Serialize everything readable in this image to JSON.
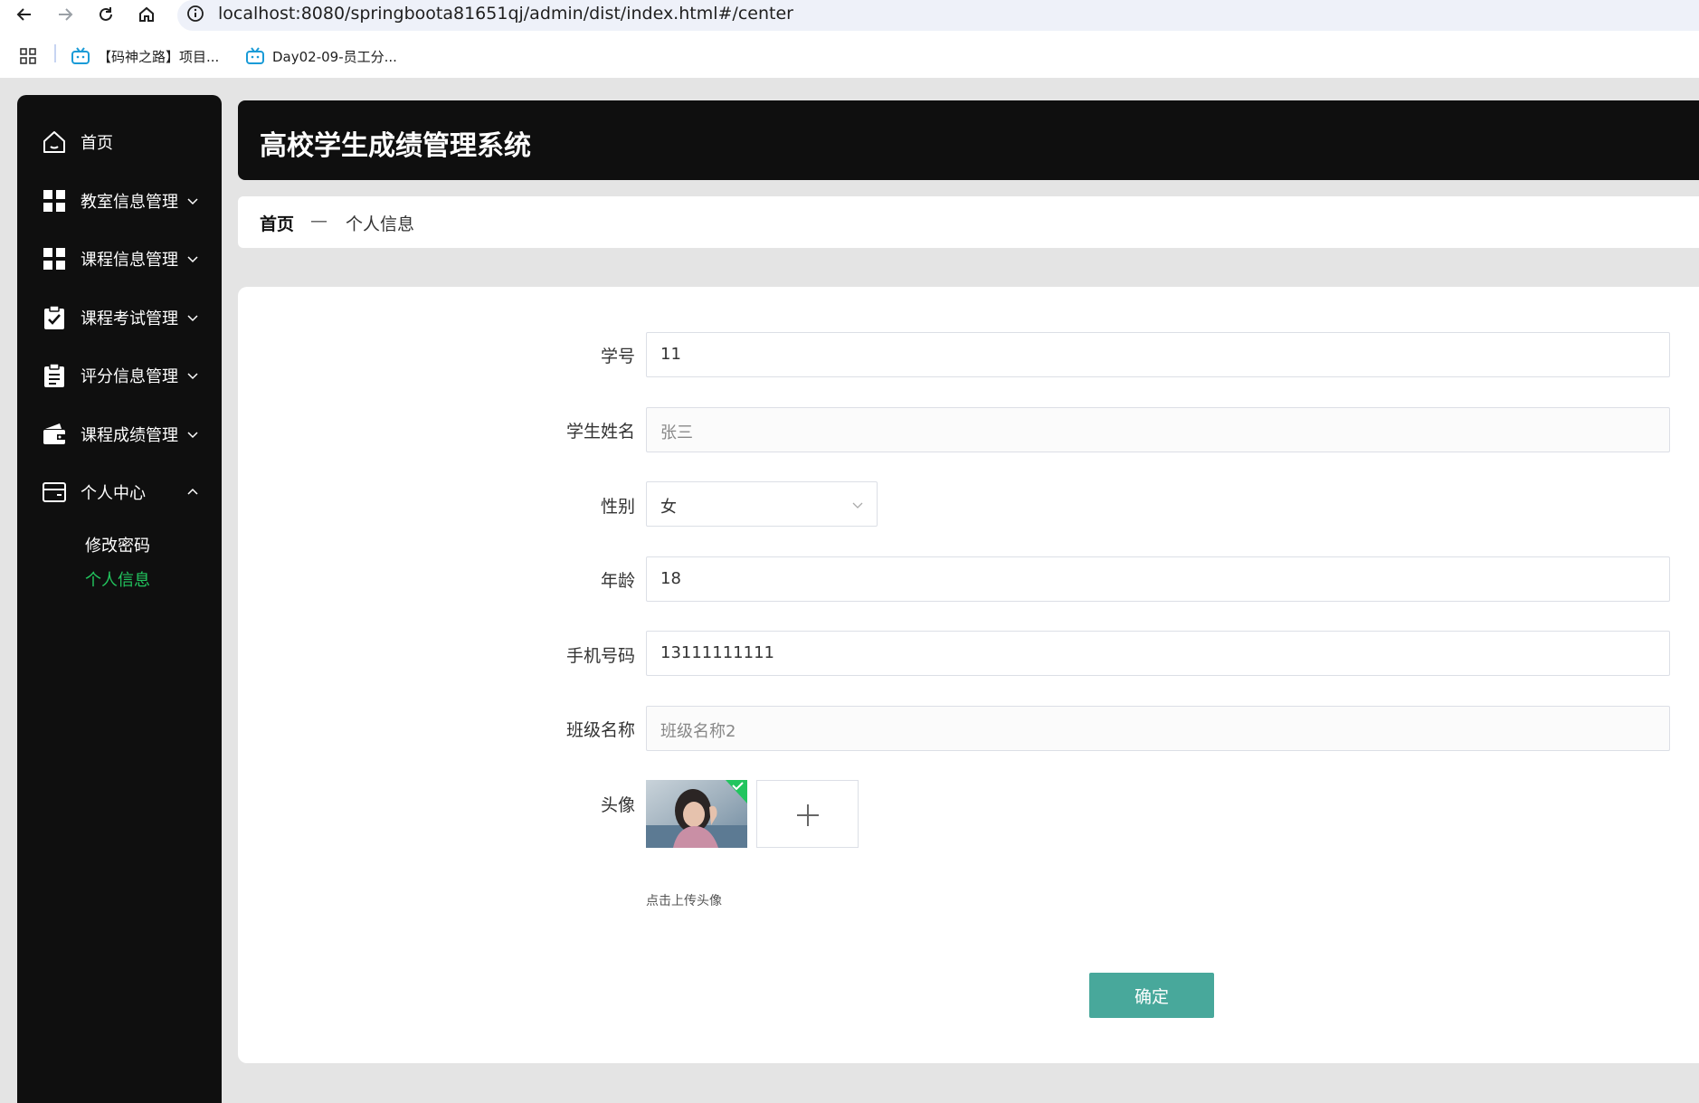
{
  "browser": {
    "url": "localhost:8080/springboota81651qj/admin/dist/index.html#/center",
    "bookmarks": [
      {
        "label": "【码神之路】项目..."
      },
      {
        "label": "Day02-09-员工分..."
      }
    ]
  },
  "sidebar": {
    "items": [
      {
        "label": "首页",
        "icon": "home-icon"
      },
      {
        "label": "教室信息管理",
        "icon": "grid-icon"
      },
      {
        "label": "课程信息管理",
        "icon": "grid-icon"
      },
      {
        "label": "课程考试管理",
        "icon": "clipboard-check-icon"
      },
      {
        "label": "评分信息管理",
        "icon": "clipboard-list-icon"
      },
      {
        "label": "课程成绩管理",
        "icon": "wallet-icon"
      },
      {
        "label": "个人中心",
        "icon": "card-icon"
      }
    ],
    "submenu": [
      {
        "label": "修改密码",
        "active": false
      },
      {
        "label": "个人信息",
        "active": true
      }
    ],
    "active_color": "#22c55e"
  },
  "header": {
    "title": "高校学生成绩管理系统"
  },
  "breadcrumb": {
    "home": "首页",
    "separator": "—",
    "current": "个人信息"
  },
  "form": {
    "student_id": {
      "label": "学号",
      "value": "11"
    },
    "student_name": {
      "label": "学生姓名",
      "value": "张三"
    },
    "gender": {
      "label": "性别",
      "value": "女"
    },
    "age": {
      "label": "年龄",
      "value": "18"
    },
    "phone": {
      "label": "手机号码",
      "value": "13111111111"
    },
    "class_name": {
      "label": "班级名称",
      "value": "班级名称2"
    },
    "avatar": {
      "label": "头像",
      "hint": "点击上传头像"
    },
    "submit_label": "确定"
  },
  "colors": {
    "accent": "#48a89b",
    "sidebar_bg": "#0f0f0f"
  }
}
